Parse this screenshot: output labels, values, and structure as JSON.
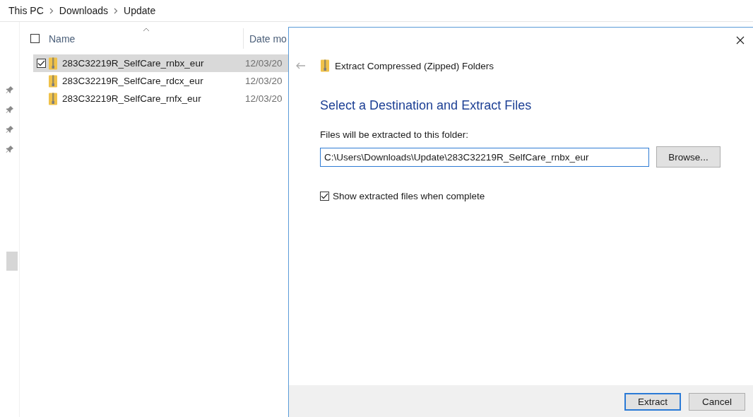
{
  "breadcrumb": [
    "This PC",
    "Downloads",
    "Update"
  ],
  "columns": [
    {
      "label": "Name",
      "sorted": true
    },
    {
      "label": "Date mo",
      "sorted": false
    }
  ],
  "header_checked": false,
  "files": [
    {
      "name": "283C32219R_SelfCare_rnbx_eur",
      "date": "12/03/20",
      "selected": true
    },
    {
      "name": "283C32219R_SelfCare_rdcx_eur",
      "date": "12/03/20",
      "selected": false
    },
    {
      "name": "283C32219R_SelfCare_rnfx_eur",
      "date": "12/03/20",
      "selected": false
    }
  ],
  "dialog": {
    "title": "Extract Compressed (Zipped) Folders",
    "heading": "Select a Destination and Extract Files",
    "field_label": "Files will be extracted to this folder:",
    "path": "C:\\Users\\Downloads\\Update\\283C32219R_SelfCare_rnbx_eur",
    "browse": "Browse...",
    "show_files": {
      "label": "Show extracted files when complete",
      "checked": true
    },
    "buttons": [
      {
        "label": "Extract",
        "default": true
      },
      {
        "label": "Cancel",
        "default": false
      }
    ]
  }
}
